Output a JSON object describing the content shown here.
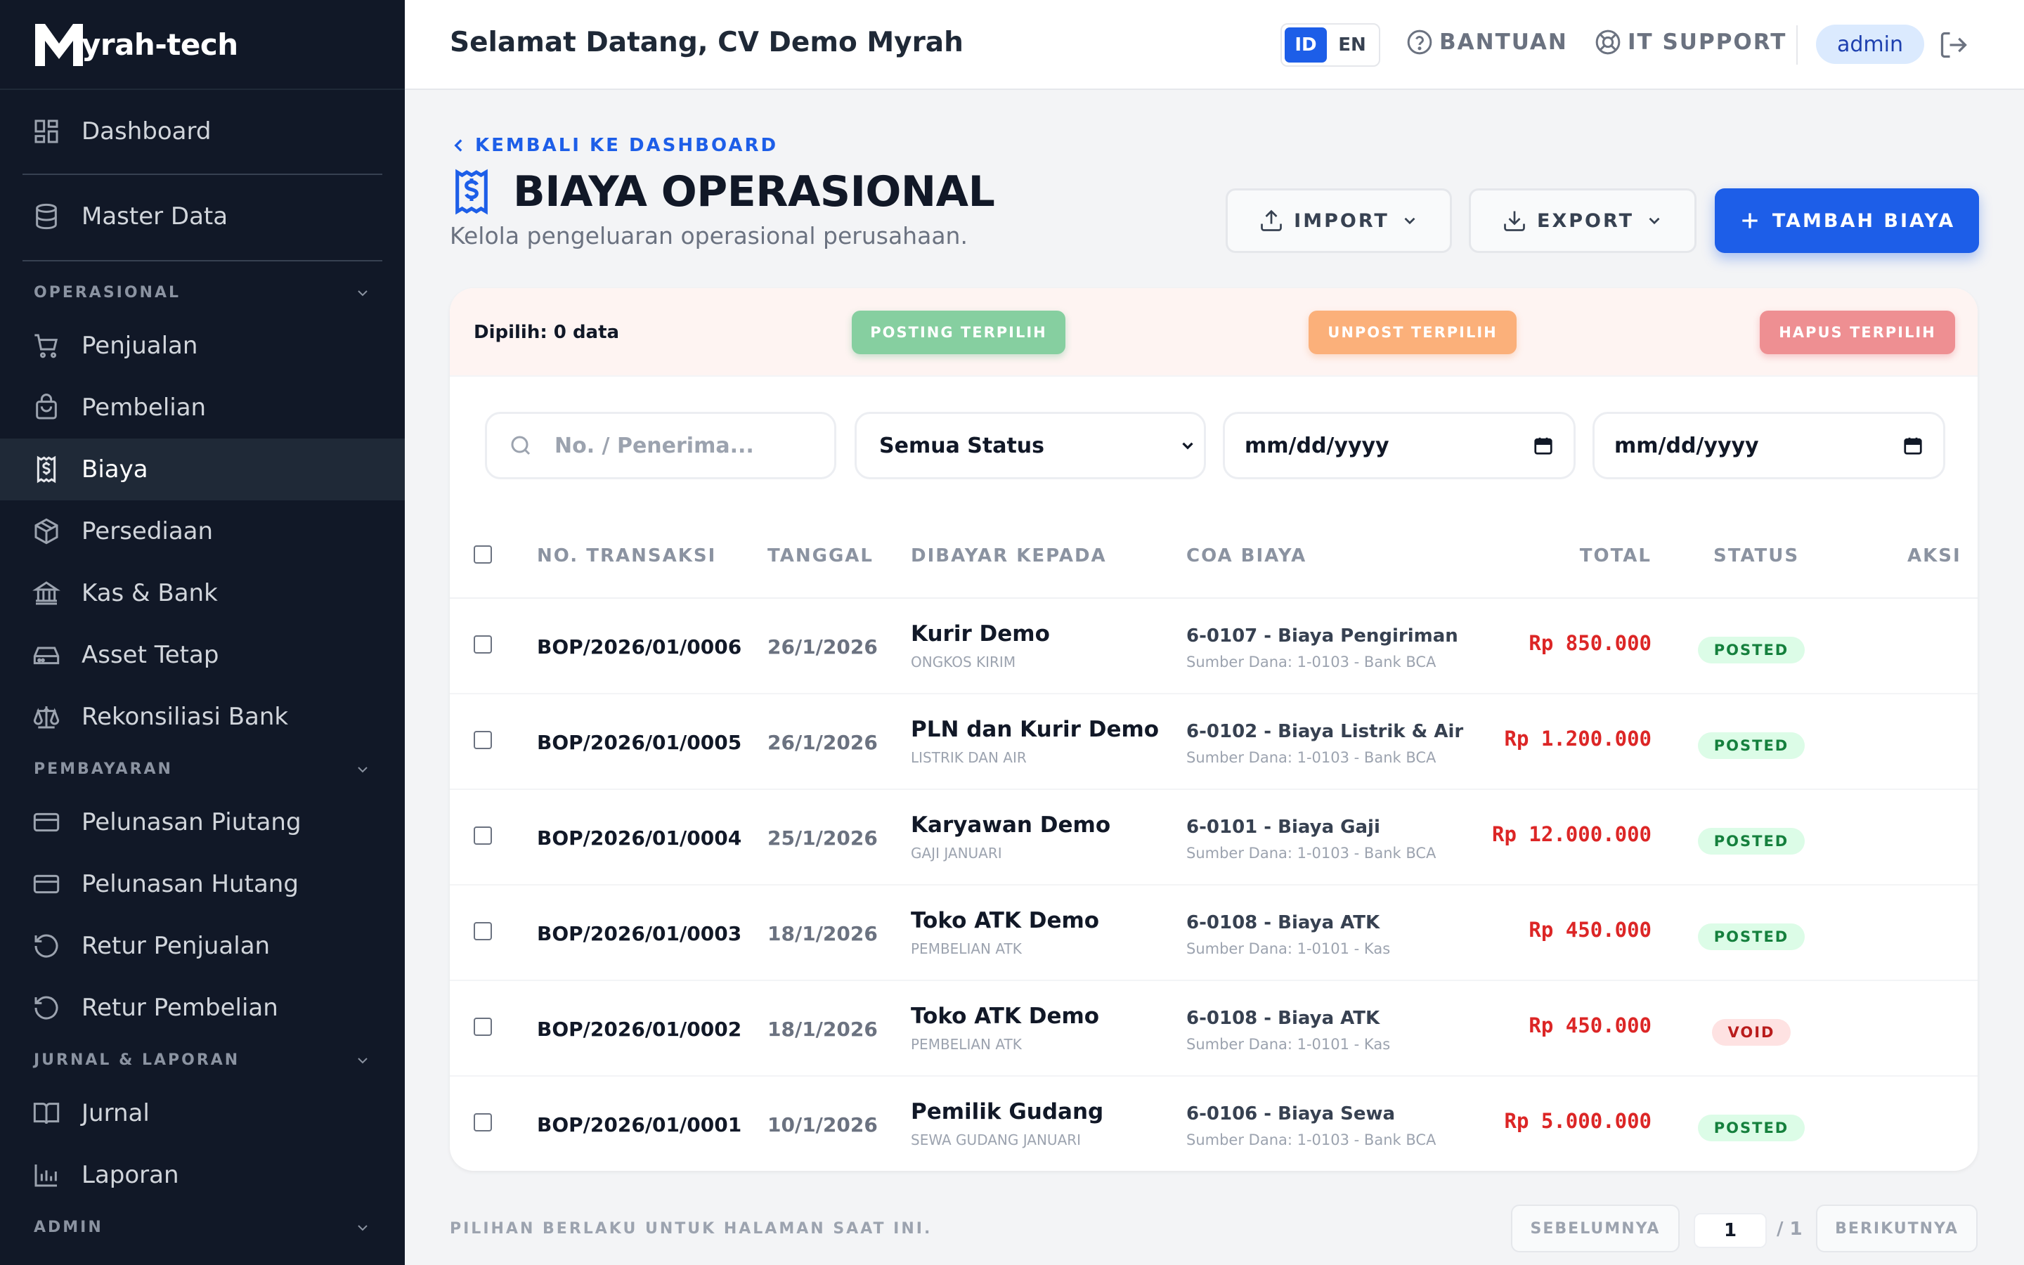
{
  "app": {
    "logo_text": "yrah-tech",
    "logo_icon": "myrah-m-logo"
  },
  "sidebar": {
    "items": [
      {
        "key": "dashboard",
        "label": "Dashboard",
        "icon": "grid-icon"
      },
      {
        "key": "master",
        "label": "Master Data",
        "icon": "database-icon"
      },
      {
        "key": "penjualan",
        "label": "Penjualan",
        "icon": "cart-icon"
      },
      {
        "key": "pembelian",
        "label": "Pembelian",
        "icon": "bag-icon"
      },
      {
        "key": "biaya",
        "label": "Biaya",
        "icon": "receipt-dollar-icon",
        "active": true
      },
      {
        "key": "persediaan",
        "label": "Persediaan",
        "icon": "box-icon"
      },
      {
        "key": "kasbank",
        "label": "Kas & Bank",
        "icon": "bank-icon"
      },
      {
        "key": "asset",
        "label": "Asset Tetap",
        "icon": "hard-drive-icon"
      },
      {
        "key": "rekon",
        "label": "Rekonsiliasi Bank",
        "icon": "scale-icon"
      },
      {
        "key": "piutang",
        "label": "Pelunasan Piutang",
        "icon": "card-icon"
      },
      {
        "key": "hutang",
        "label": "Pelunasan Hutang",
        "icon": "card-icon"
      },
      {
        "key": "returjual",
        "label": "Retur Penjualan",
        "icon": "undo-icon"
      },
      {
        "key": "returbeli",
        "label": "Retur Pembelian",
        "icon": "undo-icon"
      },
      {
        "key": "jurnal",
        "label": "Jurnal",
        "icon": "book-icon"
      },
      {
        "key": "laporan",
        "label": "Laporan",
        "icon": "chart-icon"
      }
    ],
    "sections": {
      "operasional": "OPERASIONAL",
      "pembayaran": "PEMBAYARAN",
      "jurnal": "JURNAL & LAPORAN",
      "admin": "ADMIN"
    }
  },
  "header": {
    "welcome": "Selamat Datang, CV Demo Myrah",
    "lang_id": "ID",
    "lang_en": "EN",
    "help": "BANTUAN",
    "support": "IT SUPPORT",
    "user": "admin"
  },
  "page": {
    "back": "KEMBALI KE DASHBOARD",
    "title": "BIAYA OPERASIONAL",
    "subtitle": "Kelola pengeluaran operasional perusahaan.",
    "import": "IMPORT",
    "export": "EXPORT",
    "add": "TAMBAH BIAYA"
  },
  "bulk": {
    "count": "Dipilih: 0 data",
    "post": "POSTING TERPILIH",
    "unpost": "UNPOST TERPILIH",
    "delete": "HAPUS TERPILIH"
  },
  "filters": {
    "search_placeholder": "No. / Penerima...",
    "status": "Semua Status",
    "date_from": "mm/dd/yyyy",
    "date_to": "mm/dd/yyyy"
  },
  "table": {
    "headers": {
      "no": "NO. TRANSAKSI",
      "date": "TANGGAL",
      "payee": "DIBAYAR KEPADA",
      "coa": "COA BIAYA",
      "total": "TOTAL",
      "status": "STATUS",
      "action": "AKSI"
    },
    "rows": [
      {
        "no": "BOP/2026/01/0006",
        "date": "26/1/2026",
        "payee": "Kurir Demo",
        "memo": "ONGKOS KIRIM",
        "coa": "6-0107 - Biaya Pengiriman",
        "source": "Sumber Dana: 1-0103 - Bank BCA",
        "total": "Rp 850.000",
        "status": "POSTED"
      },
      {
        "no": "BOP/2026/01/0005",
        "date": "26/1/2026",
        "payee": "PLN dan Kurir Demo",
        "memo": "LISTRIK DAN AIR",
        "coa": "6-0102 - Biaya Listrik & Air",
        "source": "Sumber Dana: 1-0103 - Bank BCA",
        "total": "Rp 1.200.000",
        "status": "POSTED"
      },
      {
        "no": "BOP/2026/01/0004",
        "date": "25/1/2026",
        "payee": "Karyawan Demo",
        "memo": "GAJI JANUARI",
        "coa": "6-0101 - Biaya Gaji",
        "source": "Sumber Dana: 1-0103 - Bank BCA",
        "total": "Rp 12.000.000",
        "status": "POSTED"
      },
      {
        "no": "BOP/2026/01/0003",
        "date": "18/1/2026",
        "payee": "Toko ATK Demo",
        "memo": "PEMBELIAN ATK",
        "coa": "6-0108 - Biaya ATK",
        "source": "Sumber Dana: 1-0101 - Kas",
        "total": "Rp 450.000",
        "status": "POSTED"
      },
      {
        "no": "BOP/2026/01/0002",
        "date": "18/1/2026",
        "payee": "Toko ATK Demo",
        "memo": "PEMBELIAN ATK",
        "coa": "6-0108 - Biaya ATK",
        "source": "Sumber Dana: 1-0101 - Kas",
        "total": "Rp 450.000",
        "status": "VOID"
      },
      {
        "no": "BOP/2026/01/0001",
        "date": "10/1/2026",
        "payee": "Pemilik Gudang",
        "memo": "SEWA GUDANG JANUARI",
        "coa": "6-0106 - Biaya Sewa",
        "source": "Sumber Dana: 1-0103 - Bank BCA",
        "total": "Rp 5.000.000",
        "status": "POSTED"
      }
    ]
  },
  "footer": {
    "note": "PILIHAN BERLAKU UNTUK HALAMAN SAAT INI.",
    "prev": "SEBELUMNYA",
    "page": "1",
    "of": "/ 1",
    "next": "BERIKUTNYA"
  },
  "colors": {
    "sidebar_bg": "#111827",
    "primary": "#1d5ee8",
    "posting": "#86cfa0",
    "unpost": "#fbb07a",
    "delete": "#ee8f92",
    "total_red": "#dc2626"
  }
}
